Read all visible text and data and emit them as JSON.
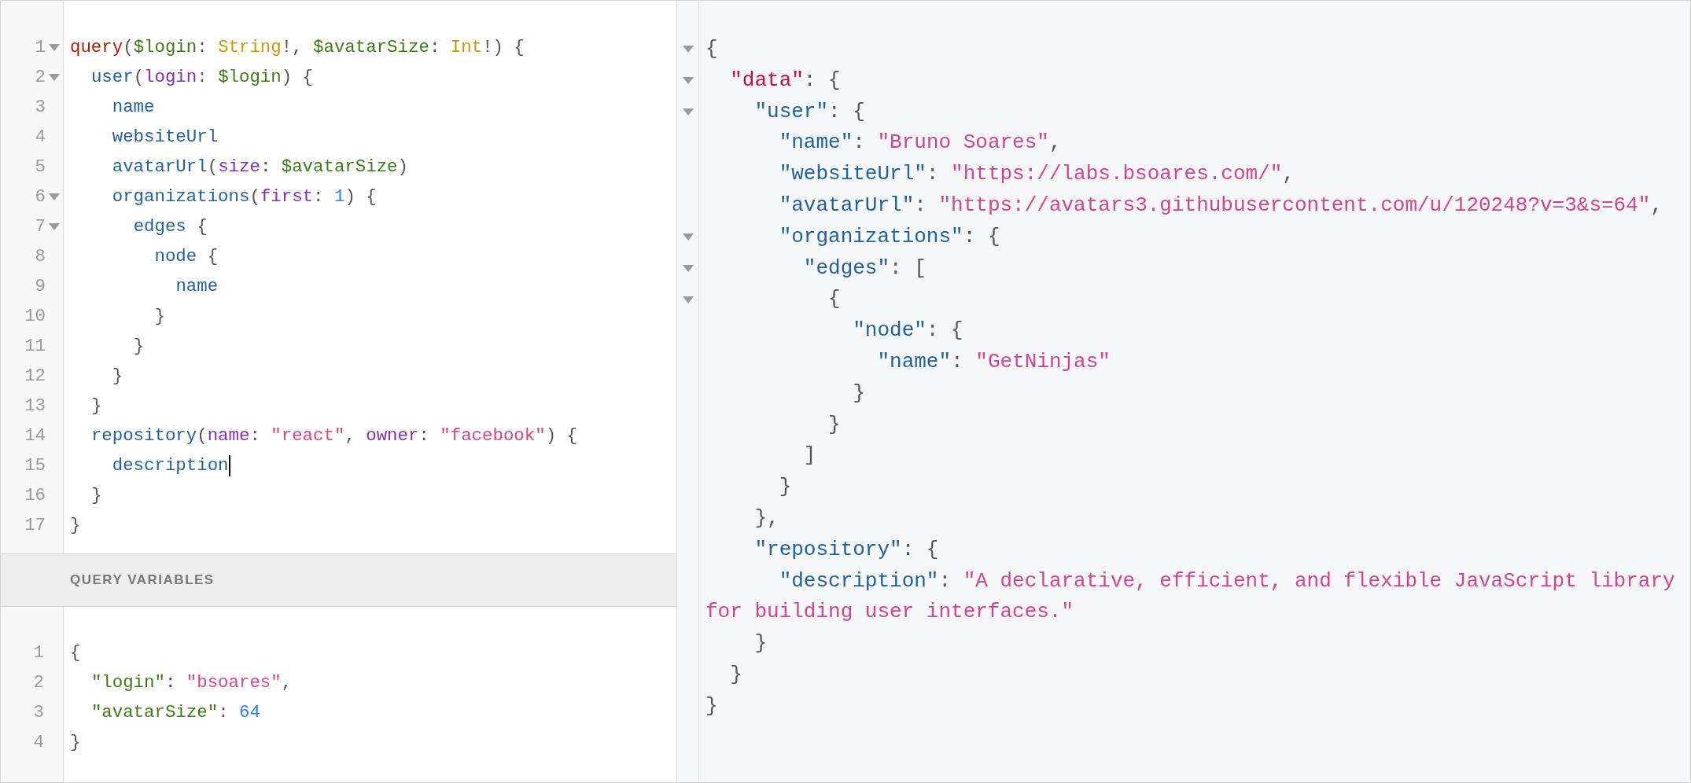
{
  "query_editor": {
    "lines": [
      {
        "number": "1",
        "foldable": true,
        "cursor": false,
        "tokens": [
          {
            "kind": "keyword",
            "text": "query"
          },
          {
            "kind": "punct",
            "text": "("
          },
          {
            "kind": "variable",
            "text": "$login"
          },
          {
            "kind": "punct",
            "text": ": "
          },
          {
            "kind": "type",
            "text": "String"
          },
          {
            "kind": "punct",
            "text": "!, "
          },
          {
            "kind": "variable",
            "text": "$avatarSize"
          },
          {
            "kind": "punct",
            "text": ": "
          },
          {
            "kind": "type",
            "text": "Int"
          },
          {
            "kind": "punct",
            "text": "!) {"
          }
        ]
      },
      {
        "number": "2",
        "foldable": true,
        "cursor": false,
        "tokens": [
          {
            "kind": "field",
            "text": "  user"
          },
          {
            "kind": "punct",
            "text": "("
          },
          {
            "kind": "attribute",
            "text": "login"
          },
          {
            "kind": "punct",
            "text": ": "
          },
          {
            "kind": "variable",
            "text": "$login"
          },
          {
            "kind": "punct",
            "text": ") {"
          }
        ]
      },
      {
        "number": "3",
        "foldable": false,
        "cursor": false,
        "tokens": [
          {
            "kind": "field",
            "text": "    name"
          }
        ]
      },
      {
        "number": "4",
        "foldable": false,
        "cursor": false,
        "tokens": [
          {
            "kind": "field",
            "text": "    websiteUrl"
          }
        ]
      },
      {
        "number": "5",
        "foldable": false,
        "cursor": false,
        "tokens": [
          {
            "kind": "field",
            "text": "    avatarUrl"
          },
          {
            "kind": "punct",
            "text": "("
          },
          {
            "kind": "attribute",
            "text": "size"
          },
          {
            "kind": "punct",
            "text": ": "
          },
          {
            "kind": "variable",
            "text": "$avatarSize"
          },
          {
            "kind": "punct",
            "text": ")"
          }
        ]
      },
      {
        "number": "6",
        "foldable": true,
        "cursor": false,
        "tokens": [
          {
            "kind": "field",
            "text": "    organizations"
          },
          {
            "kind": "punct",
            "text": "("
          },
          {
            "kind": "attribute",
            "text": "first"
          },
          {
            "kind": "punct",
            "text": ": "
          },
          {
            "kind": "number",
            "text": "1"
          },
          {
            "kind": "punct",
            "text": ") {"
          }
        ]
      },
      {
        "number": "7",
        "foldable": true,
        "cursor": false,
        "tokens": [
          {
            "kind": "field",
            "text": "      edges"
          },
          {
            "kind": "punct",
            "text": " {"
          }
        ]
      },
      {
        "number": "8",
        "foldable": false,
        "cursor": false,
        "tokens": [
          {
            "kind": "field",
            "text": "        node"
          },
          {
            "kind": "punct",
            "text": " {"
          }
        ]
      },
      {
        "number": "9",
        "foldable": false,
        "cursor": false,
        "tokens": [
          {
            "kind": "field",
            "text": "          name"
          }
        ]
      },
      {
        "number": "10",
        "foldable": false,
        "cursor": false,
        "tokens": [
          {
            "kind": "punct",
            "text": "        }"
          }
        ]
      },
      {
        "number": "11",
        "foldable": false,
        "cursor": false,
        "tokens": [
          {
            "kind": "punct",
            "text": "      }"
          }
        ]
      },
      {
        "number": "12",
        "foldable": false,
        "cursor": false,
        "tokens": [
          {
            "kind": "punct",
            "text": "    }"
          }
        ]
      },
      {
        "number": "13",
        "foldable": false,
        "cursor": false,
        "tokens": [
          {
            "kind": "punct",
            "text": "  }"
          }
        ]
      },
      {
        "number": "14",
        "foldable": false,
        "cursor": false,
        "tokens": [
          {
            "kind": "field",
            "text": "  repository"
          },
          {
            "kind": "punct",
            "text": "("
          },
          {
            "kind": "attribute",
            "text": "name"
          },
          {
            "kind": "punct",
            "text": ": "
          },
          {
            "kind": "string",
            "text": "\"react\""
          },
          {
            "kind": "punct",
            "text": ", "
          },
          {
            "kind": "attribute",
            "text": "owner"
          },
          {
            "kind": "punct",
            "text": ": "
          },
          {
            "kind": "string",
            "text": "\"facebook\""
          },
          {
            "kind": "punct",
            "text": ") {"
          }
        ]
      },
      {
        "number": "15",
        "foldable": false,
        "cursor": true,
        "tokens": [
          {
            "kind": "field",
            "text": "    description"
          }
        ]
      },
      {
        "number": "16",
        "foldable": false,
        "cursor": false,
        "tokens": [
          {
            "kind": "punct",
            "text": "  }"
          }
        ]
      },
      {
        "number": "17",
        "foldable": false,
        "cursor": false,
        "tokens": [
          {
            "kind": "punct",
            "text": "}"
          }
        ]
      }
    ]
  },
  "variables_panel": {
    "title": "QUERY VARIABLES",
    "lines": [
      {
        "number": "1",
        "tokens": [
          {
            "kind": "punct",
            "text": "{"
          }
        ]
      },
      {
        "number": "2",
        "tokens": [
          {
            "kind": "variable",
            "text": "  \"login\""
          },
          {
            "kind": "punct",
            "text": ": "
          },
          {
            "kind": "string",
            "text": "\"bsoares\""
          },
          {
            "kind": "punct",
            "text": ","
          }
        ]
      },
      {
        "number": "3",
        "tokens": [
          {
            "kind": "variable",
            "text": "  \"avatarSize\""
          },
          {
            "kind": "punct",
            "text": ": "
          },
          {
            "kind": "number",
            "text": "64"
          }
        ]
      },
      {
        "number": "4",
        "tokens": [
          {
            "kind": "punct",
            "text": "}"
          }
        ]
      }
    ]
  },
  "result_viewer": {
    "lines": [
      {
        "foldable": true,
        "tokens": [
          {
            "kind": "punct",
            "text": "{"
          }
        ]
      },
      {
        "foldable": true,
        "tokens": [
          {
            "kind": "toplevel",
            "text": "  \"data\""
          },
          {
            "kind": "punct",
            "text": ": {"
          }
        ]
      },
      {
        "foldable": true,
        "tokens": [
          {
            "kind": "key",
            "text": "    \"user\""
          },
          {
            "kind": "punct",
            "text": ": {"
          }
        ]
      },
      {
        "foldable": false,
        "tokens": [
          {
            "kind": "key",
            "text": "      \"name\""
          },
          {
            "kind": "punct",
            "text": ": "
          },
          {
            "kind": "string",
            "text": "\"Bruno Soares\""
          },
          {
            "kind": "punct",
            "text": ","
          }
        ]
      },
      {
        "foldable": false,
        "tokens": [
          {
            "kind": "key",
            "text": "      \"websiteUrl\""
          },
          {
            "kind": "punct",
            "text": ": "
          },
          {
            "kind": "string",
            "text": "\"https://labs.bsoares.com/\""
          },
          {
            "kind": "punct",
            "text": ","
          }
        ]
      },
      {
        "foldable": false,
        "tokens": [
          {
            "kind": "key",
            "text": "      \"avatarUrl\""
          },
          {
            "kind": "punct",
            "text": ": "
          },
          {
            "kind": "string",
            "text": "\"https://avatars3.githubusercontent.com/u/120248?v=3&s=64\""
          },
          {
            "kind": "punct",
            "text": ","
          }
        ]
      },
      {
        "foldable": true,
        "tokens": [
          {
            "kind": "key",
            "text": "      \"organizations\""
          },
          {
            "kind": "punct",
            "text": ": {"
          }
        ]
      },
      {
        "foldable": true,
        "tokens": [
          {
            "kind": "key",
            "text": "        \"edges\""
          },
          {
            "kind": "punct",
            "text": ": ["
          }
        ]
      },
      {
        "foldable": true,
        "tokens": [
          {
            "kind": "punct",
            "text": "          {"
          }
        ]
      },
      {
        "foldable": false,
        "tokens": [
          {
            "kind": "key",
            "text": "            \"node\""
          },
          {
            "kind": "punct",
            "text": ": {"
          }
        ]
      },
      {
        "foldable": false,
        "tokens": [
          {
            "kind": "key",
            "text": "              \"name\""
          },
          {
            "kind": "punct",
            "text": ": "
          },
          {
            "kind": "string",
            "text": "\"GetNinjas\""
          }
        ]
      },
      {
        "foldable": false,
        "tokens": [
          {
            "kind": "punct",
            "text": "            }"
          }
        ]
      },
      {
        "foldable": false,
        "tokens": [
          {
            "kind": "punct",
            "text": "          }"
          }
        ]
      },
      {
        "foldable": false,
        "tokens": [
          {
            "kind": "punct",
            "text": "        ]"
          }
        ]
      },
      {
        "foldable": false,
        "tokens": [
          {
            "kind": "punct",
            "text": "      }"
          }
        ]
      },
      {
        "foldable": false,
        "tokens": [
          {
            "kind": "punct",
            "text": "    },"
          }
        ]
      },
      {
        "foldable": false,
        "tokens": [
          {
            "kind": "key",
            "text": "    \"repository\""
          },
          {
            "kind": "punct",
            "text": ": {"
          }
        ]
      },
      {
        "foldable": false,
        "tokens": [
          {
            "kind": "key",
            "text": "      \"description\""
          },
          {
            "kind": "punct",
            "text": ": "
          },
          {
            "kind": "string",
            "text": "\"A declarative, efficient, and flexible JavaScript library for building user interfaces.\""
          }
        ]
      },
      {
        "foldable": false,
        "tokens": [
          {
            "kind": "punct",
            "text": "    }"
          }
        ]
      },
      {
        "foldable": false,
        "tokens": [
          {
            "kind": "punct",
            "text": "  }"
          }
        ]
      },
      {
        "foldable": false,
        "tokens": [
          {
            "kind": "punct",
            "text": "}"
          }
        ]
      }
    ]
  }
}
